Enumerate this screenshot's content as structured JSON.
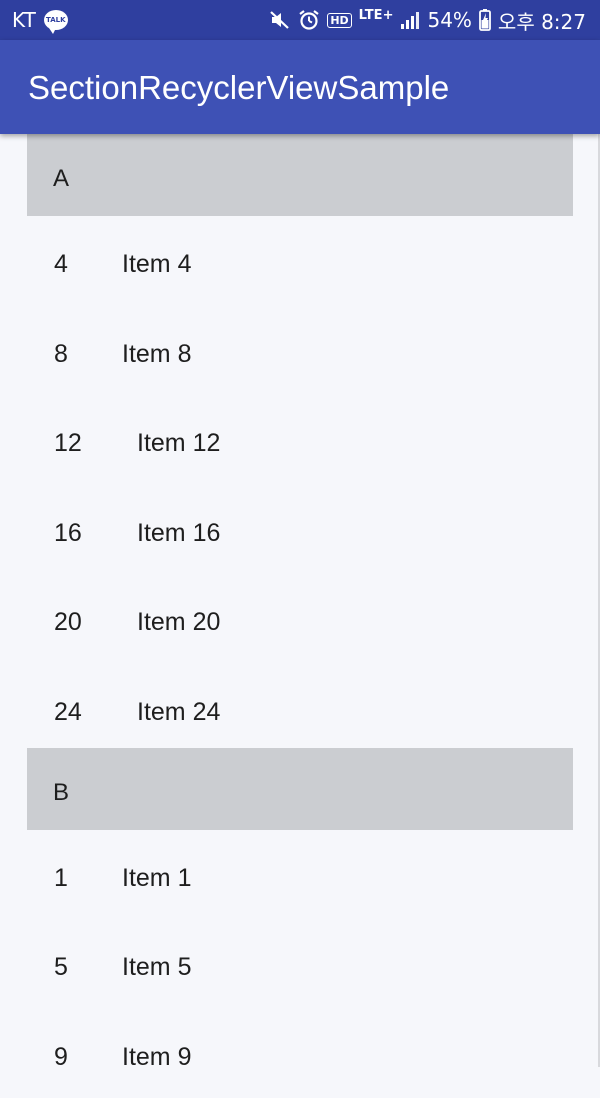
{
  "status_bar": {
    "carrier": "KT",
    "talk_badge": "TALK",
    "hd": "HD",
    "network": "LTE",
    "network_sup": "+",
    "battery_percent": "54%",
    "time": "오후 8:27"
  },
  "toolbar": {
    "title": "SectionRecyclerViewSample"
  },
  "sections": [
    {
      "title": "A",
      "items": [
        {
          "number": "4",
          "label": "Item 4"
        },
        {
          "number": "8",
          "label": "Item 8"
        },
        {
          "number": "12",
          "label": "Item 12"
        },
        {
          "number": "16",
          "label": "Item 16"
        },
        {
          "number": "20",
          "label": "Item 20"
        },
        {
          "number": "24",
          "label": "Item 24"
        }
      ]
    },
    {
      "title": "B",
      "items": [
        {
          "number": "1",
          "label": "Item 1"
        },
        {
          "number": "5",
          "label": "Item 5"
        },
        {
          "number": "9",
          "label": "Item 9"
        }
      ]
    }
  ],
  "colors": {
    "status_bar": "#2f3f9f",
    "toolbar": "#3e51b5",
    "section_header": "#cbcdd1",
    "background": "#f6f7fb"
  }
}
